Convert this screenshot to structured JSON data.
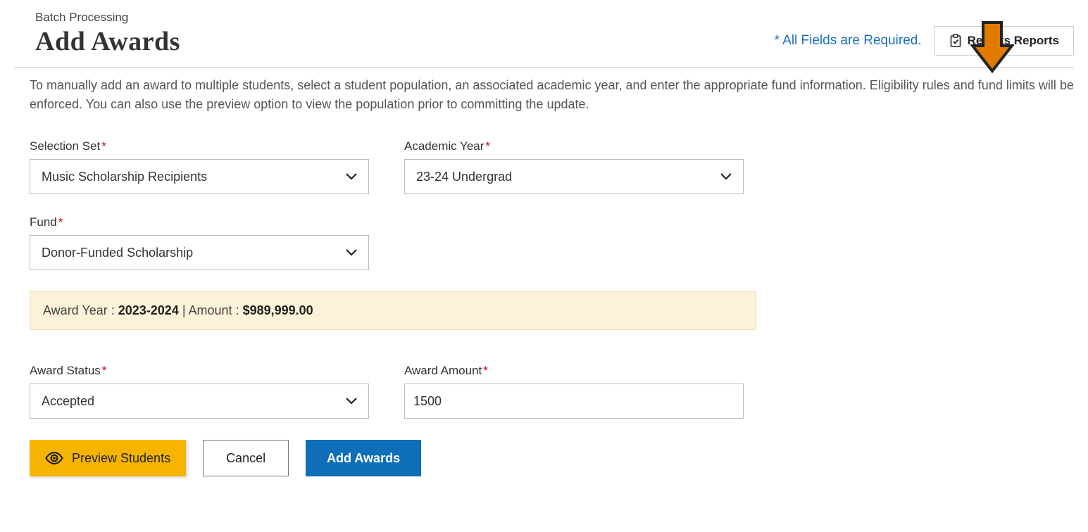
{
  "breadcrumb": "Batch Processing",
  "page_title": "Add Awards",
  "required_note": "* All Fields are Required.",
  "results_button_label": "Results Reports",
  "description": "To manually add an award to multiple students, select a student population, an associated academic year, and enter the appropriate fund information. Eligibility rules and fund limits will be enforced. You can also use the preview option to view the population prior to committing the update.",
  "fields": {
    "selection_set": {
      "label": "Selection Set",
      "value": "Music Scholarship Recipients"
    },
    "academic_year": {
      "label": "Academic Year",
      "value": "23-24 Undergrad"
    },
    "fund": {
      "label": "Fund",
      "value": "Donor-Funded Scholarship"
    },
    "award_status": {
      "label": "Award Status",
      "value": "Accepted"
    },
    "award_amount": {
      "label": "Award Amount",
      "value": "1500"
    }
  },
  "info_bar": {
    "award_year_label": "Award Year : ",
    "award_year_value": "2023-2024",
    "separator": " | ",
    "amount_label": "Amount : ",
    "amount_value": "$989,999.00"
  },
  "buttons": {
    "preview": "Preview Students",
    "cancel": "Cancel",
    "add": "Add Awards"
  }
}
